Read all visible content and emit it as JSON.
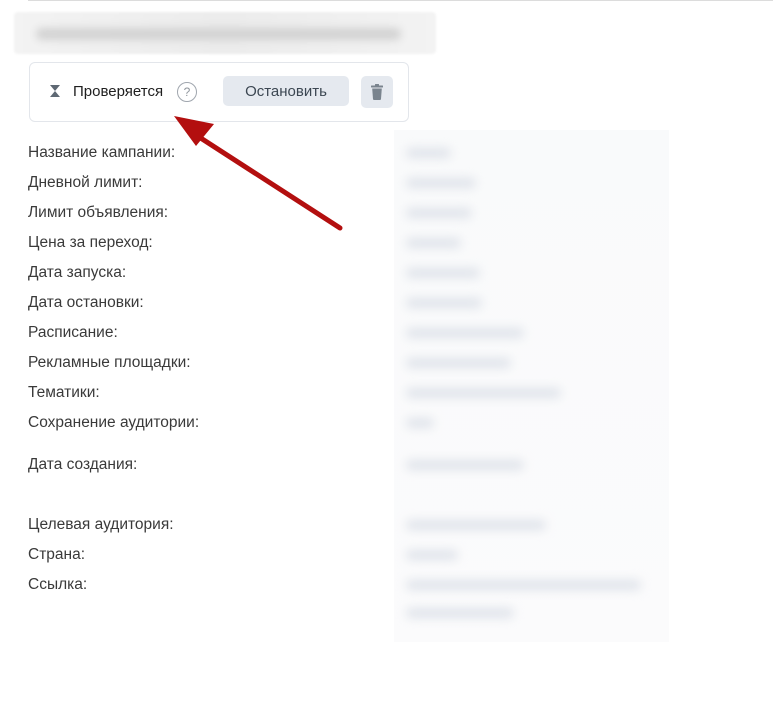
{
  "status": {
    "label": "Проверяется",
    "help_symbol": "?",
    "stop_label": "Остановить"
  },
  "fields": [
    "Название кампании:",
    "Дневной лимит:",
    "Лимит объявления:",
    "Цена за переход:",
    "Дата запуска:",
    "Дата остановки:",
    "Расписание:",
    "Рекламные площадки:",
    "Тематики:",
    "Сохранение аудитории:",
    "Дата создания:",
    "Целевая аудитория:",
    "Страна:",
    "Ссылка:"
  ],
  "colors": {
    "annotation_arrow": "#b30f0f",
    "button_bg": "#e5e9ef"
  },
  "icons": {
    "status": "hourglass-icon",
    "help": "question-circle-icon",
    "delete": "trash-icon"
  }
}
